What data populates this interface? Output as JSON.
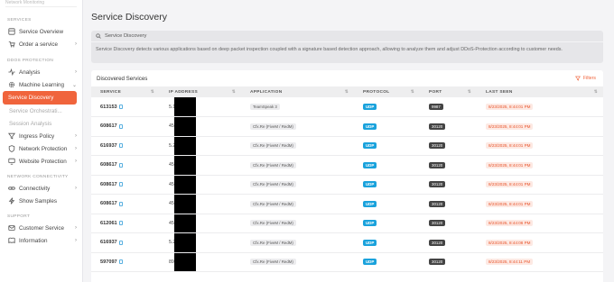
{
  "sidebar": {
    "top_cut": "Network Monitoring",
    "sections": {
      "services": "SERVICES",
      "ddos": "DDOS PROTECTION",
      "netconn": "NETWORK CONNECTIVITY",
      "support": "SUPPORT"
    },
    "items": {
      "service_overview": "Service Overview",
      "order_service": "Order a service",
      "analysis": "Analysis",
      "machine_learning": "Machine Learning",
      "service_discovery": "Service Discovery",
      "service_orchestration": "Service Orchestrati...",
      "session_analysis": "Session Analysis",
      "ingress_policy": "Ingress Policy",
      "network_protection": "Network Protection",
      "website_protection": "Website Protection",
      "connectivity": "Connectivity",
      "show_samples": "Show Samples",
      "customer_service": "Customer Service",
      "information": "Information"
    }
  },
  "page": {
    "title": "Service Discovery"
  },
  "info": {
    "heading": "Service Discovery",
    "text": "Service Discovery detects various applications based on deep packet inspection coupled with a signature based detection approach, allowing to analyze them and adjust DDoS-Protection according to customer needs."
  },
  "card": {
    "title": "Discovered Services",
    "filters_label": "Filters"
  },
  "table": {
    "headers": [
      "SERVICE",
      "IP ADDRESS",
      "APPLICATION",
      "PROTOCOL",
      "PORT",
      "LAST SEEN"
    ],
    "rows": [
      {
        "service": "613153",
        "ip": "5.18",
        "application": "TeamSpeak 3",
        "protocol": "UDP",
        "port": "9987",
        "last_seen": "8/23/2025, 8:44:01 PM"
      },
      {
        "service": "608617",
        "ip": "45.1",
        "application": "Cfx.Re (FiveM / RedM)",
        "protocol": "UDP",
        "port": "30120",
        "last_seen": "8/23/2025, 8:44:01 PM"
      },
      {
        "service": "616937",
        "ip": "5.25",
        "application": "Cfx.Re (FiveM / RedM)",
        "protocol": "UDP",
        "port": "30120",
        "last_seen": "8/23/2025, 8:44:01 PM"
      },
      {
        "service": "608617",
        "ip": "45.1",
        "application": "Cfx.Re (FiveM / RedM)",
        "protocol": "UDP",
        "port": "30120",
        "last_seen": "8/23/2025, 8:44:01 PM"
      },
      {
        "service": "608617",
        "ip": "45.1",
        "application": "Cfx.Re (FiveM / RedM)",
        "protocol": "UDP",
        "port": "30120",
        "last_seen": "8/23/2025, 8:44:01 PM"
      },
      {
        "service": "608617",
        "ip": "45.1",
        "application": "Cfx.Re (FiveM / RedM)",
        "protocol": "UDP",
        "port": "30120",
        "last_seen": "8/23/2025, 8:44:01 PM"
      },
      {
        "service": "612061",
        "ip": "45.1",
        "application": "Cfx.Re (FiveM / RedM)",
        "protocol": "UDP",
        "port": "30120",
        "last_seen": "8/23/2025, 8:44:06 PM"
      },
      {
        "service": "616937",
        "ip": "5.25",
        "application": "Cfx.Re (FiveM / RedM)",
        "protocol": "UDP",
        "port": "30120",
        "last_seen": "8/23/2025, 8:44:08 PM"
      },
      {
        "service": "597097",
        "ip": "89.",
        "application": "Cfx.Re (FiveM / RedM)",
        "protocol": "UDP",
        "port": "30120",
        "last_seen": "8/23/2025, 8:44:11 PM"
      }
    ]
  },
  "colors": {
    "accent": "#f0643c",
    "protocol": "#1aa2dc",
    "port": "#444444",
    "last_seen_text": "#e8552c"
  }
}
